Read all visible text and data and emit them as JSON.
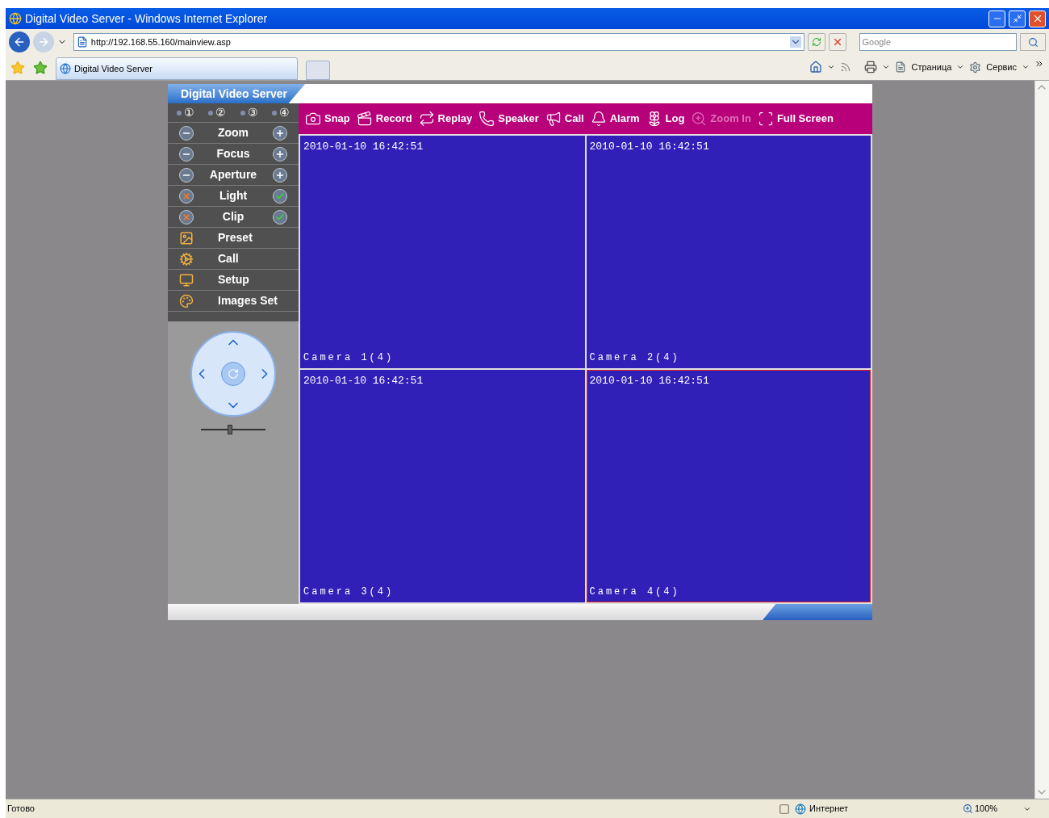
{
  "window": {
    "title": "Digital Video Server - Windows Internet Explorer"
  },
  "address_bar": {
    "url": "http://192.168.55.160/mainview.asp"
  },
  "search": {
    "placeholder": "Google"
  },
  "tabs": [
    {
      "label": "Digital Video Server",
      "selected": true
    }
  ],
  "command_bar": [
    "Страница",
    "Сервис"
  ],
  "app": {
    "title": "Digital Video Server",
    "channels": [
      {
        "label": "①"
      },
      {
        "label": "②"
      },
      {
        "label": "③"
      },
      {
        "label": "④"
      }
    ],
    "controls": [
      {
        "kind": "pair",
        "label": "Zoom"
      },
      {
        "kind": "pair",
        "label": "Focus"
      },
      {
        "kind": "pair",
        "label": "Aperture"
      },
      {
        "kind": "toggle",
        "label": "Light"
      },
      {
        "kind": "toggle",
        "label": "Clip"
      },
      {
        "kind": "menu",
        "label": "Preset"
      },
      {
        "kind": "menu",
        "label": "Call"
      },
      {
        "kind": "menu",
        "label": "Setup"
      },
      {
        "kind": "menu",
        "label": "Images Set"
      }
    ],
    "ptz_speed": {
      "level": 0.45
    },
    "toolbar": [
      {
        "label": "Snap",
        "disabled": false
      },
      {
        "label": "Record",
        "disabled": false
      },
      {
        "label": "Replay",
        "disabled": false
      },
      {
        "label": "Speaker",
        "disabled": false
      },
      {
        "label": "Call",
        "disabled": false
      },
      {
        "label": "Alarm",
        "disabled": false
      },
      {
        "label": "Log",
        "disabled": false
      },
      {
        "label": "Zoom In",
        "disabled": true
      },
      {
        "label": "Full Screen",
        "disabled": false
      }
    ],
    "cameras": [
      {
        "timestamp": "2010-01-10 16:42:51",
        "name": "Camera 1(4)",
        "selected": false
      },
      {
        "timestamp": "2010-01-10 16:42:51",
        "name": "Camera 2(4)",
        "selected": false
      },
      {
        "timestamp": "2010-01-10 16:42:51",
        "name": "Camera 3(4)",
        "selected": false
      },
      {
        "timestamp": "2010-01-10 16:42:51",
        "name": "Camera 4(4)",
        "selected": true
      }
    ]
  },
  "status_bar": {
    "text": "Готово",
    "zone": "Интернет",
    "zoom": "100%"
  }
}
